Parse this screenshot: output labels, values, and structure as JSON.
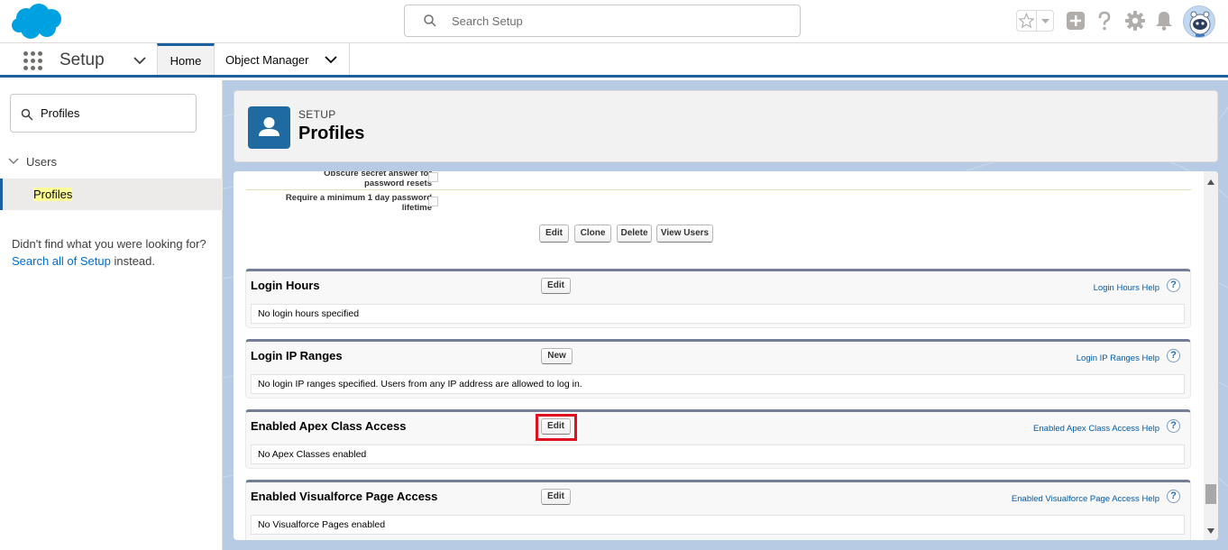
{
  "header": {
    "search_placeholder": "Search Setup"
  },
  "nav": {
    "app_name": "Setup",
    "tabs": [
      {
        "label": "Home"
      },
      {
        "label": "Object Manager"
      }
    ]
  },
  "sidebar": {
    "quick_find_value": "Profiles",
    "tree_parent": "Users",
    "tree_child": "Profiles",
    "not_found_pre": "Didn't find what you were looking for? ",
    "not_found_link": "Search all of Setup",
    "not_found_post": " instead."
  },
  "page_header": {
    "eyebrow": "SETUP",
    "title": "Profiles"
  },
  "fields": {
    "partial_row": "password resets",
    "partial_row_top": "Obscure secret answer for",
    "min_lifetime_line1": "Require a minimum 1 day password",
    "min_lifetime_line2": "lifetime"
  },
  "action_buttons": [
    "Edit",
    "Clone",
    "Delete",
    "View Users"
  ],
  "sections": [
    {
      "title": "Login Hours",
      "button": "Edit",
      "help": "Login Hours Help",
      "body": "No login hours specified"
    },
    {
      "title": "Login IP Ranges",
      "button": "New",
      "help": "Login IP Ranges Help",
      "body": "No login IP ranges specified. Users from any IP address are allowed to log in."
    },
    {
      "title": "Enabled Apex Class Access",
      "button": "Edit",
      "help": "Enabled Apex Class Access Help",
      "body": "No Apex Classes enabled"
    },
    {
      "title": "Enabled Visualforce Page Access",
      "button": "Edit",
      "help": "Enabled Visualforce Page Access Help",
      "body": "No Visualforce Pages enabled"
    }
  ],
  "help_icon_glyph": "?",
  "colors": {
    "brand_blue": "#1b5f9e",
    "link_blue": "#006dcc",
    "highlight_red": "#e0101f",
    "salesforce_cloud": "#00a1e0"
  }
}
